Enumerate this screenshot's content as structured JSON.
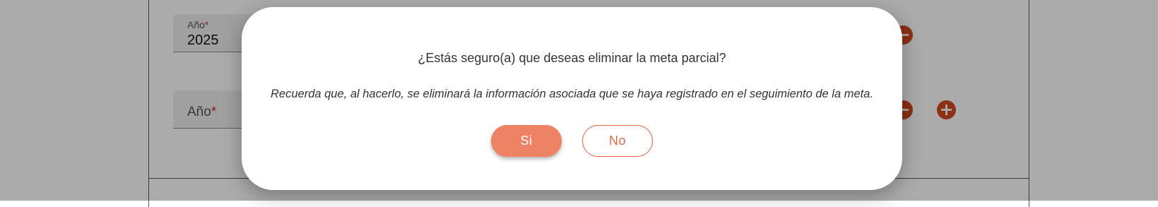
{
  "background": {
    "fields": [
      {
        "label": "Año",
        "required_mark": "*",
        "value": "2025"
      },
      {
        "label": "Año",
        "required_mark": "*",
        "value": ""
      }
    ],
    "icons": {
      "remove": "minus-circle-icon",
      "add": "plus-circle-icon"
    },
    "icon_glyphs": {
      "remove": "−",
      "add": "+"
    }
  },
  "dialog": {
    "question": "¿Estás seguro(a) que deseas eliminar la meta parcial?",
    "note": "Recuerda que, al hacerlo, se eliminará la información asociada que se haya registrado en el seguimiento de la meta.",
    "confirm_label": "Si",
    "cancel_label": "No"
  },
  "colors": {
    "accent": "#ee8265",
    "accent_dark": "#e5684a",
    "action_icon": "#d2481f",
    "overlay": "rgba(0,0,0,0.33)"
  }
}
